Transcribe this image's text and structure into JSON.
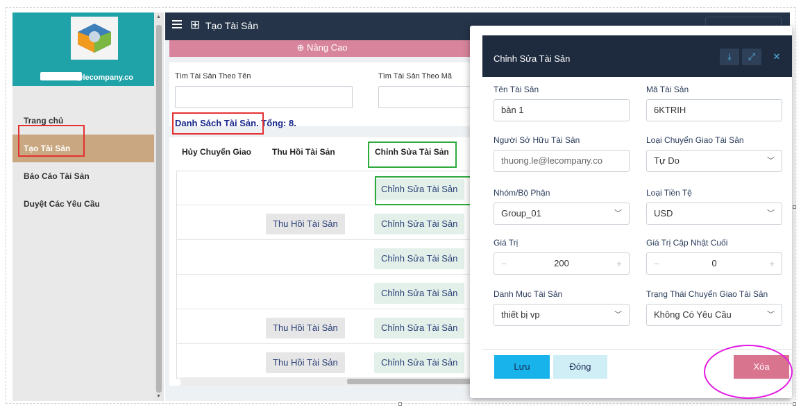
{
  "sidebar": {
    "user_email": "@lecompany.co",
    "items": [
      {
        "label": "Trang chủ"
      },
      {
        "label": "Tạo Tài Sản"
      },
      {
        "label": "Báo Cáo Tài Sản"
      },
      {
        "label": "Duyệt Các Yêu Cầu"
      }
    ]
  },
  "header": {
    "title": "Tạo Tài Sản"
  },
  "advanced": {
    "label": "Nâng Cao",
    "icon": "arrow-up-circle-icon"
  },
  "search": {
    "by_name_label": "Tìm Tài Sản Theo Tên",
    "by_code_label": "Tìm Tài Sản Theo Mã"
  },
  "list": {
    "title": "Danh Sách Tài Sản.",
    "total": "Tổng: 8."
  },
  "table": {
    "columns": [
      "Hủy Chuyển Giao",
      "Thu Hồi Tài Sản",
      "Chỉnh Sửa Tài Sản"
    ],
    "rows": [
      {
        "recall": "",
        "edit": "Chỉnh Sửa Tài Sản"
      },
      {
        "recall": "Thu Hồi Tài Sản",
        "edit": "Chỉnh Sửa Tài Sản"
      },
      {
        "recall": "",
        "edit": "Chỉnh Sửa Tài Sản"
      },
      {
        "recall": "",
        "edit": "Chỉnh Sửa Tài Sản"
      },
      {
        "recall": "Thu Hồi Tài Sản",
        "edit": "Chỉnh Sửa Tài Sản"
      },
      {
        "recall": "Thu Hồi Tài Sản",
        "edit": "Chỉnh Sửa Tài Sản"
      }
    ]
  },
  "modal": {
    "title": "Chỉnh Sửa Tài Sản",
    "icons": [
      "download-icon",
      "external-link-icon",
      "close-icon"
    ],
    "fields": {
      "name": {
        "label": "Tên Tài Sản",
        "value": "bàn 1"
      },
      "code": {
        "label": "Mã Tài Sản",
        "value": "6KTRIH"
      },
      "owner": {
        "label": "Người Sở Hữu Tài Sản",
        "value": "thuong.le@lecompany.co"
      },
      "transfer_type": {
        "label": "Loại Chuyển Giao Tài Sản",
        "value": "Tự Do"
      },
      "group": {
        "label": "Nhóm/Bộ Phận",
        "value": "Group_01"
      },
      "currency": {
        "label": "Loại Tiền Tệ",
        "value": "USD"
      },
      "value": {
        "label": "Giá Trị",
        "value": "200"
      },
      "last_value": {
        "label": "Giá Trị Cập Nhật Cuối",
        "value": "0"
      },
      "category": {
        "label": "Danh Mục Tài Sản",
        "value": "thiết bị vp"
      },
      "transfer_status": {
        "label": "Trạng Thái Chuyển Giao Tài Sản",
        "value": "Không Có Yêu Cầu"
      }
    },
    "buttons": {
      "save": "Lưu",
      "close": "Đóng",
      "delete": "Xóa"
    }
  },
  "colors": {
    "topbar": "#253449",
    "sidebar_header": "#1fa3a8",
    "active_menu": "#c9a780",
    "save": "#17b3ea",
    "delete": "#d9748f",
    "annotation_red": "#e53030",
    "annotation_green": "#2daa3c",
    "annotation_magenta": "#e21ae2"
  }
}
